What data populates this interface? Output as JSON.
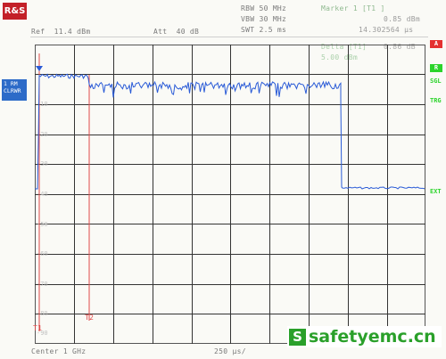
{
  "logo_text": "R&S",
  "header": {
    "rbw": "RBW 50 MHz",
    "vbw": "VBW 30 MHz",
    "swt": "SWT 2.5 ms",
    "ref": "Ref  11.4 dBm",
    "att": "Att  40 dB",
    "marker_title": "Marker 1 [T1 ]",
    "marker_level": "0.85 dBm",
    "marker_time": "14.302564 μs",
    "delta_label": "Delta [T1]",
    "delta_value": "0.86 dB",
    "delta_time": "5.00 dBm"
  },
  "trace_label": {
    "line1": "1 RM",
    "line2": "CLRWR"
  },
  "side_tags": {
    "a_box": "A",
    "r_box": "R",
    "sgl": "SGL",
    "trg": "TRG",
    "ext": "EXT"
  },
  "markers": {
    "t1": "T1",
    "t2": "T2"
  },
  "y_tick_labels": [
    "-10",
    "-20",
    "-30",
    "-40",
    "-50",
    "-60",
    "-70",
    "-80",
    "-90"
  ],
  "footer": {
    "center": "Center 1 GHz",
    "span": "250 μs/"
  },
  "watermark": {
    "icon": "S",
    "text": "safetyemc.cn"
  },
  "colors": {
    "trace": "#2a5bd7",
    "marker_line": "#e04a4a",
    "grid": "#333333",
    "logo": "#c32028",
    "watermark": "#2aa02a"
  }
}
